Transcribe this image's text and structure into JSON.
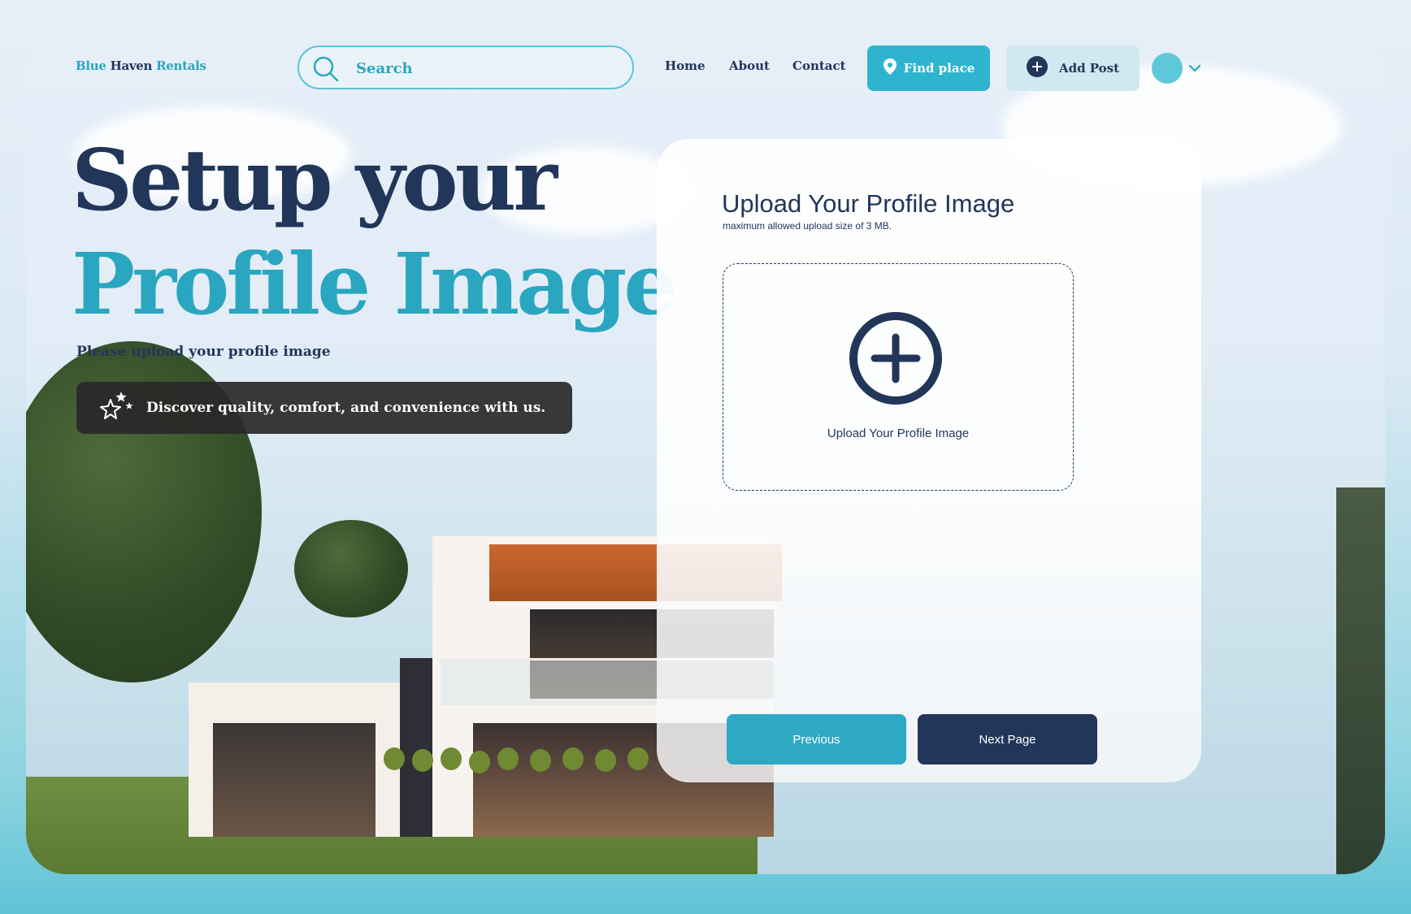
{
  "brand": {
    "part1": "Blue",
    "part2": "Haven",
    "part3": "Rentals"
  },
  "search": {
    "placeholder": "Search"
  },
  "nav": {
    "home": "Home",
    "about": "About",
    "contact": "Contact"
  },
  "actions": {
    "find_place": "Find place",
    "add_post": "Add Post"
  },
  "hero": {
    "title_line1": "Setup your",
    "title_line2": "Profile Image",
    "subtitle": "Please upload your profile image",
    "banner": "Discover quality, comfort, and convenience with us."
  },
  "upload_card": {
    "title": "Upload Your Profile Image",
    "subtitle": "maximum allowed upload size of 3 MB.",
    "dropzone_label": "Upload Your Profile Image",
    "previous": "Previous",
    "next": "Next Page"
  },
  "colors": {
    "navy": "#22365a",
    "teal": "#2aa6c0",
    "button_teal": "#2fb4cf",
    "banner_bg": "#282828"
  },
  "icons": [
    "search-icon",
    "location-pin-icon",
    "plus-circle-icon",
    "chevron-down-icon",
    "sparkle-stars-icon",
    "plus-circle-large-icon"
  ]
}
